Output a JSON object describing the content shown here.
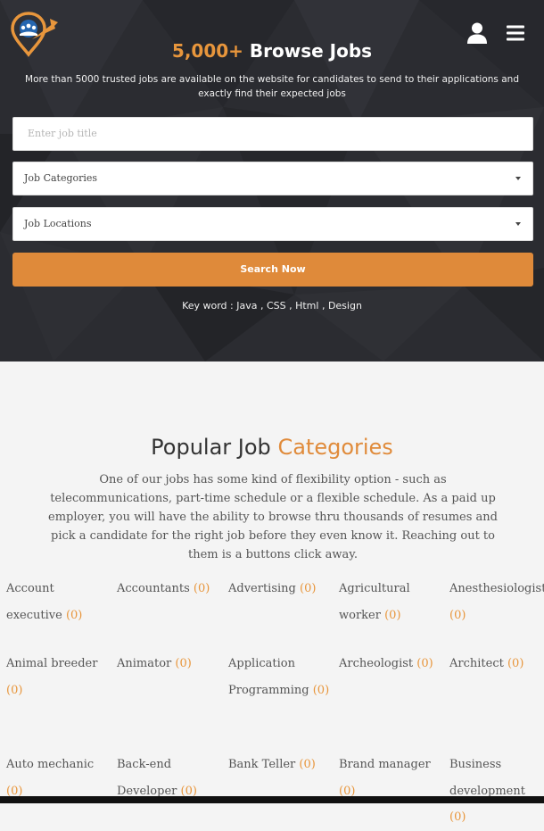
{
  "header": {
    "logo_icon": "job-portal-logo",
    "user_icon": "user-icon",
    "menu_icon": "hamburger-menu-icon",
    "title_accent": "5,000+",
    "title_rest": "Browse Jobs",
    "subtitle": "More than 5000 trusted jobs are available on the website for candidates to send to their applications and exactly find their expected jobs"
  },
  "search": {
    "job_title_placeholder": "Enter job title",
    "categories_select": "Job Categories",
    "locations_select": "Job Locations",
    "button_label": "Search Now",
    "keywords": "Key word : Java , CSS , Html , Design"
  },
  "categories_section": {
    "title_part1": "Popular Job",
    "title_accent": "Categories",
    "description": "One of our jobs has some kind of flexibility option - such as telecommunications, part-time schedule or a flexible schedule. As a paid up employer, you will have the ability to browse thru thousands of resumes and pick a candidate for the right job before they even know it. Reaching out to them is a buttons click away.",
    "items": [
      {
        "name": "Account executive",
        "count": "(0)"
      },
      {
        "name": "Accountants",
        "count": "(0)"
      },
      {
        "name": "Advertising",
        "count": "(0)"
      },
      {
        "name": "Agricultural worker",
        "count": "(0)"
      },
      {
        "name": "Anesthesiologist",
        "count": "(0)"
      },
      {
        "name": "Animal breeder",
        "count": "(0)"
      },
      {
        "name": "Animator",
        "count": "(0)"
      },
      {
        "name": "Application Programming",
        "count": "(0)"
      },
      {
        "name": "Archeologist",
        "count": "(0)"
      },
      {
        "name": "Architect",
        "count": "(0)"
      },
      {
        "name": "Auto mechanic",
        "count": "(0)"
      },
      {
        "name": "Back-end Developer",
        "count": "(0)"
      },
      {
        "name": "Bank Teller",
        "count": "(0)"
      },
      {
        "name": "Brand manager",
        "count": "(0)"
      },
      {
        "name": "Business development",
        "count": "(0)"
      }
    ]
  },
  "colors": {
    "accent": "#e8963c",
    "hero_bg": "#2b2c31",
    "button": "#df8a3a"
  }
}
